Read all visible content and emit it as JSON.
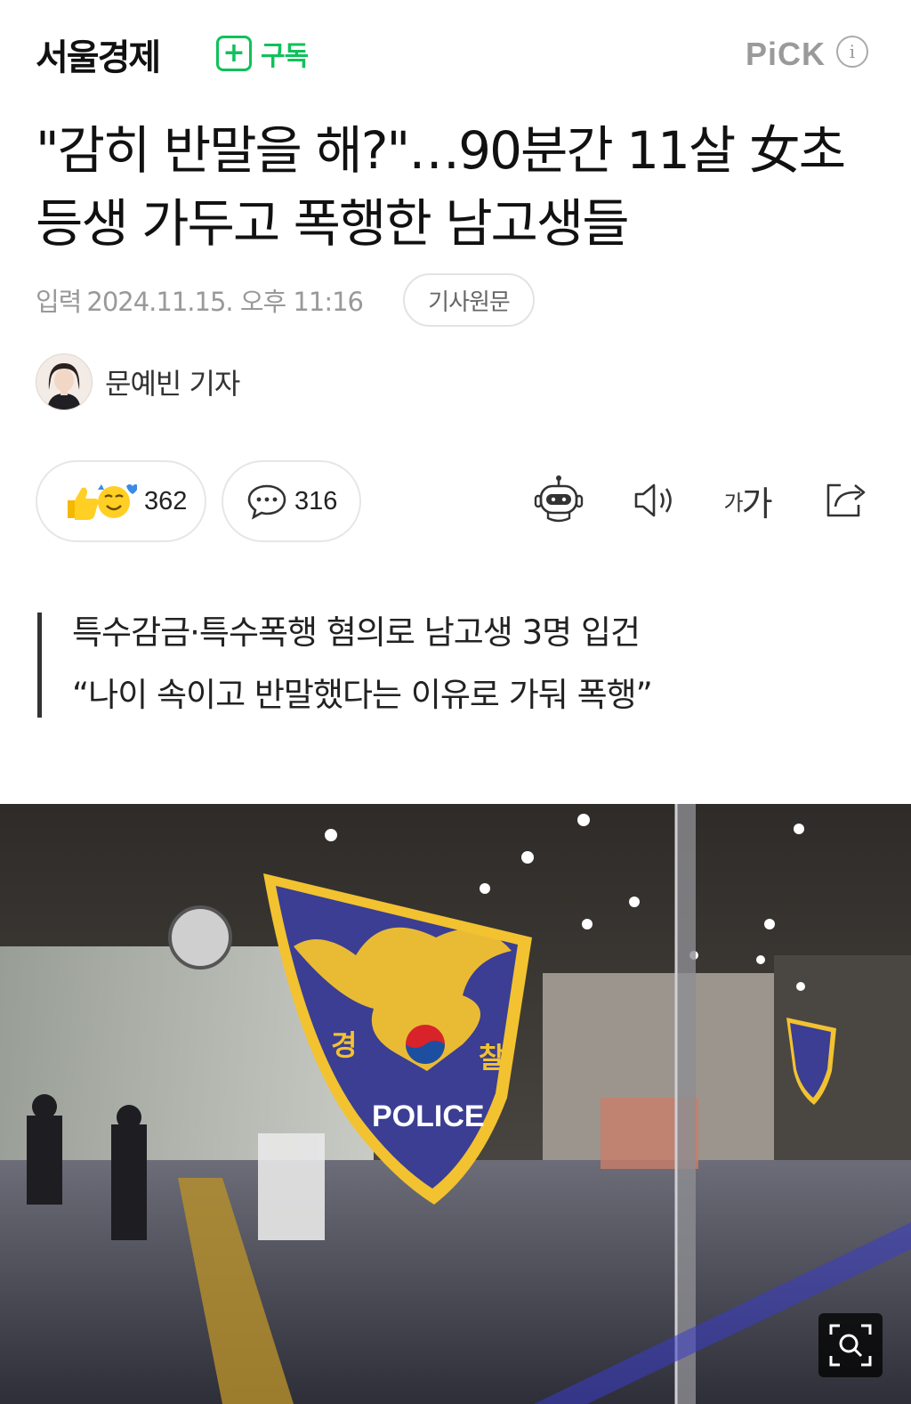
{
  "header": {
    "press_name": "서울경제",
    "subscribe_label": "구독",
    "pick_label": "PiCK",
    "info_glyph": "i"
  },
  "article": {
    "title": "\"감히 반말을 해?\"…90분간 11살 女초등생 가두고 폭행한 남고생들",
    "input_label": "입력",
    "date": "2024.11.15. 오후 11:16",
    "original_button": "기사원문",
    "reporter": "문예빈 기자",
    "summary": [
      "특수감금·특수폭행 혐의로 남고생 3명 입건",
      "“나이 속이고 반말했다는 이유로 가둬 폭행”"
    ]
  },
  "actions": {
    "reaction_count": "362",
    "comment_count": "316",
    "font_size_small": "가",
    "font_size_large": "가",
    "icons": [
      "reaction-emoji-icon",
      "comment-bubble-icon",
      "robot-summary-icon",
      "speaker-icon",
      "share-icon"
    ]
  },
  "photo": {
    "badge_left": "경",
    "badge_right": "찰",
    "badge_text": "POLICE",
    "colors": {
      "badge_blue": "#3b3e92",
      "badge_gold": "#f2c230"
    }
  },
  "colors": {
    "subscribe_green": "#10c15b",
    "muted_gray": "#999999"
  }
}
